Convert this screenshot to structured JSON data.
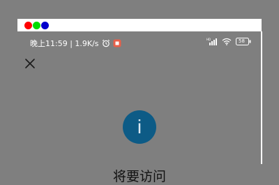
{
  "status": {
    "time_speed": "晚上11:59 | 1.9K/s",
    "battery": "58"
  },
  "dialog": {
    "info_glyph": "i",
    "title": "将要访问"
  },
  "colors": {
    "background": "#7f7f7f",
    "info_circle": "#0d5b86"
  }
}
